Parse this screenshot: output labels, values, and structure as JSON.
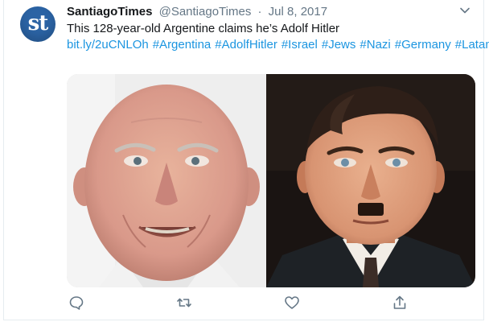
{
  "tweet": {
    "avatar_text": "st",
    "display_name": "SantiagoTimes",
    "handle": "@SantiagoTimes",
    "separator": "·",
    "date": "Jul 8, 2017",
    "text": "This 128-year-old Argentine claims he’s Adolf Hitler",
    "link": "bit.ly/2uCNLOh",
    "hashtags": [
      "#Argentina",
      "#AdolfHitler",
      "#Israel",
      "#Jews",
      "#Nazi",
      "#Germany",
      "#Latam"
    ]
  },
  "colors": {
    "link": "#1b95e0",
    "text": "#14171a",
    "secondary": "#657786",
    "avatar_bg": "#2b63a4"
  },
  "icons": {
    "reply": "reply-icon",
    "retweet": "retweet-icon",
    "like": "like-icon",
    "share": "share-icon",
    "caret": "chevron-down-icon"
  }
}
